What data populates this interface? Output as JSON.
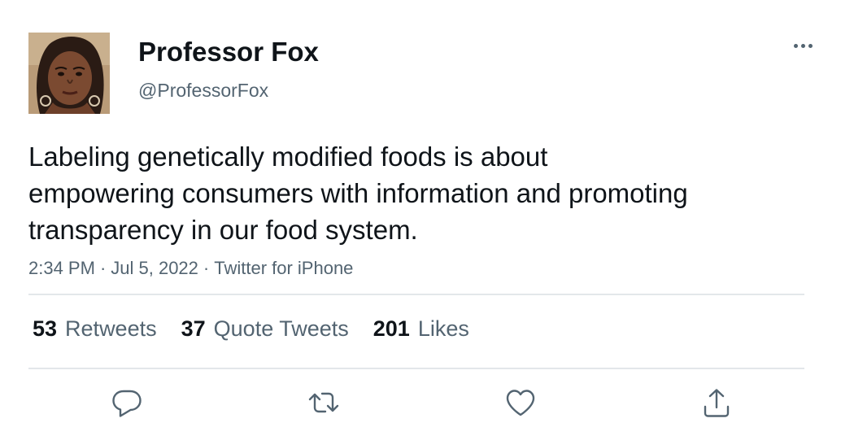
{
  "author": {
    "display_name": "Professor Fox",
    "handle": "@ProfessorFox",
    "avatar_icon": "profile-photo"
  },
  "tweet": {
    "text_lines": [
      "Labeling genetically modified foods is about",
      "empowering consumers with information and promoting",
      "transparency in our food system."
    ],
    "time": "2:34 PM",
    "date": "Jul 5, 2022",
    "source": "Twitter for iPhone",
    "separator": "·"
  },
  "stats": {
    "retweets": {
      "count": "53",
      "label": "Retweets"
    },
    "quote_tweets": {
      "count": "37",
      "label": "Quote Tweets"
    },
    "likes": {
      "count": "201",
      "label": "Likes"
    }
  },
  "actions": {
    "reply_icon": "reply-icon",
    "retweet_icon": "retweet-icon",
    "like_icon": "heart-icon",
    "share_icon": "share-icon",
    "more_icon": "more-icon"
  },
  "colors": {
    "text_primary": "#0f1419",
    "text_secondary": "#536471",
    "divider": "#e3e7ea"
  }
}
